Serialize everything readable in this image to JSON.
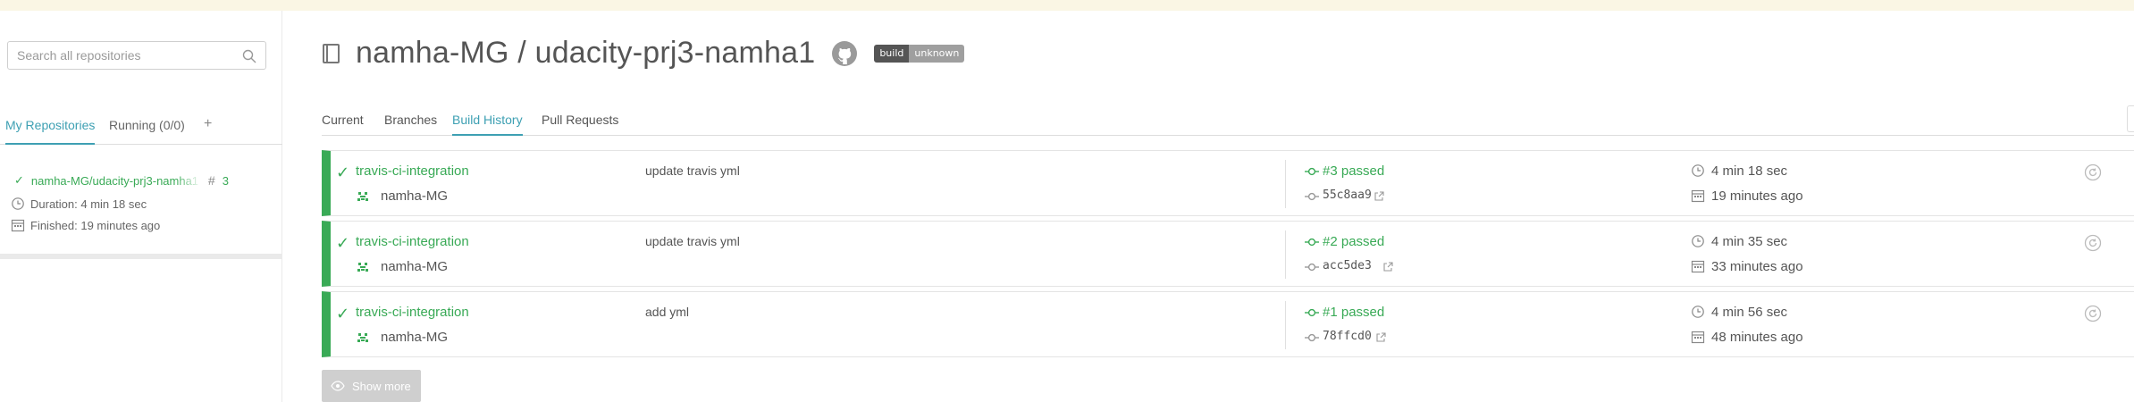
{
  "sidebar": {
    "search_placeholder": "Search all repositories",
    "tabs": [
      {
        "label": "My Repositories"
      },
      {
        "label": "Running (0/0)"
      },
      {
        "label": "+"
      }
    ],
    "repo": {
      "name": "namha-MG/udacity-prj3-namha1",
      "build_number": "3",
      "duration": "Duration: 4 min 18 sec",
      "finished": "Finished: 19 minutes ago"
    }
  },
  "header": {
    "title": "namha-MG / udacity-prj3-namha1",
    "badge_left": "build",
    "badge_right": "unknown"
  },
  "tabs": [
    {
      "label": "Current"
    },
    {
      "label": "Branches"
    },
    {
      "label": "Build History"
    },
    {
      "label": "Pull Requests"
    }
  ],
  "builds": [
    {
      "branch": "travis-ci-integration",
      "author": "namha-MG",
      "message": "update travis yml",
      "status": "#3 passed",
      "sha": "55c8aa9",
      "duration": "4 min 18 sec",
      "finished": "19 minutes ago"
    },
    {
      "branch": "travis-ci-integration",
      "author": "namha-MG",
      "message": "update travis yml",
      "status": "#2 passed",
      "sha": "acc5de3",
      "duration": "4 min 35 sec",
      "finished": "33 minutes ago"
    },
    {
      "branch": "travis-ci-integration",
      "author": "namha-MG",
      "message": "add yml",
      "status": "#1 passed",
      "sha": "78ffcd0",
      "duration": "4 min 56 sec",
      "finished": "48 minutes ago"
    }
  ],
  "show_more_label": "Show more",
  "colors": {
    "passed": "#39aa56",
    "accent": "#3ea0b3",
    "notice_bar": "#faf6e4"
  }
}
